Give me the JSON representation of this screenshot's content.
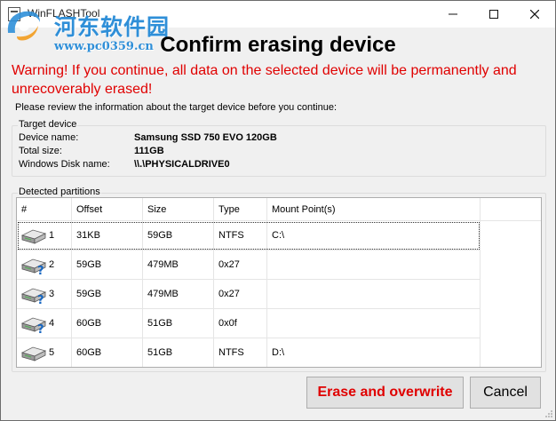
{
  "window": {
    "title": "WinFLASHTool"
  },
  "watermark": {
    "site_name": "河东软件园",
    "url": "www.pc0359.cn"
  },
  "dialog": {
    "heading": "Confirm erasing device",
    "warning": "Warning! If you continue, all data on the selected device will be permanently and unrecoverably erased!",
    "instruction": "Please review the information about the target device before you continue:"
  },
  "target_device": {
    "legend": "Target device",
    "fields": [
      {
        "label": "Device name:",
        "value": "Samsung SSD 750 EVO 120GB"
      },
      {
        "label": "Total size:",
        "value": "111GB"
      },
      {
        "label": "Windows Disk name:",
        "value": "\\\\.\\PHYSICALDRIVE0"
      }
    ]
  },
  "partitions": {
    "legend": "Detected partitions",
    "columns": [
      "#",
      "Offset",
      "Size",
      "Type",
      "Mount Point(s)"
    ],
    "rows": [
      {
        "num": "1",
        "offset": "31KB",
        "size": "59GB",
        "type": "NTFS",
        "mount": "C:\\",
        "icon": "hard-drive-icon"
      },
      {
        "num": "2",
        "offset": "59GB",
        "size": "479MB",
        "type": "0x27",
        "mount": "",
        "icon": "unknown-drive-icon"
      },
      {
        "num": "3",
        "offset": "59GB",
        "size": "479MB",
        "type": "0x27",
        "mount": "",
        "icon": "unknown-drive-icon"
      },
      {
        "num": "4",
        "offset": "60GB",
        "size": "51GB",
        "type": "0x0f",
        "mount": "",
        "icon": "unknown-drive-icon"
      },
      {
        "num": "5",
        "offset": "60GB",
        "size": "51GB",
        "type": "NTFS",
        "mount": "D:\\",
        "icon": "hard-drive-icon"
      }
    ]
  },
  "buttons": {
    "erase": "Erase and overwrite",
    "cancel": "Cancel"
  },
  "colors": {
    "warning": "#e00000",
    "watermark": "#2f8fd8"
  }
}
